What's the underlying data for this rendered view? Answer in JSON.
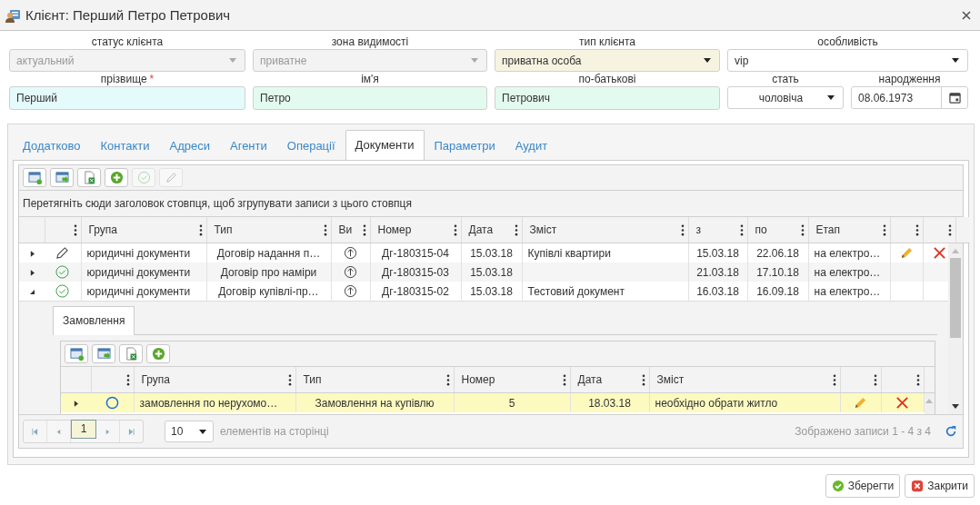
{
  "window": {
    "title": "Клієнт: Перший Петро Петрович"
  },
  "fields": [
    {
      "kind": "select",
      "label": "статус клієнта",
      "value": "актуальний",
      "disabled": true,
      "color": "#f3f3f3"
    },
    {
      "kind": "select",
      "label": "зона видимості",
      "value": "приватне",
      "disabled": true,
      "color": "#f3f3f3"
    },
    {
      "kind": "select",
      "label": "тип клієнта",
      "value": "приватна особа",
      "disabled": false,
      "color": "#f6f4e0"
    },
    {
      "kind": "select",
      "label": "особливість",
      "value": "vip",
      "disabled": false,
      "color": "#ffffff"
    },
    {
      "kind": "input",
      "label": "прізвище",
      "required_mark": "*",
      "value": "Перший",
      "color": "#e5fbfb"
    },
    {
      "kind": "input",
      "label": "ім'я",
      "value": "Петро",
      "color": "#e3fbee"
    },
    {
      "kind": "input",
      "label": "по-батькові",
      "value": "Петрович",
      "color": "#e3fbee"
    },
    {
      "kind": "select",
      "label": "стать",
      "value": "чоловіча",
      "disabled": false,
      "color": "#ffffff"
    },
    {
      "kind": "date",
      "label": "народження",
      "value": "08.06.1973",
      "color": "#ffffff"
    }
  ],
  "tabs": [
    {
      "label": "Додатково",
      "selected": false
    },
    {
      "label": "Контакти",
      "selected": false
    },
    {
      "label": "Адреси",
      "selected": false
    },
    {
      "label": "Агенти",
      "selected": false
    },
    {
      "label": "Операції",
      "selected": false
    },
    {
      "label": "Документи",
      "selected": true
    },
    {
      "label": "Параметри",
      "selected": false
    },
    {
      "label": "Аудит",
      "selected": false
    }
  ],
  "toolbar": [
    {
      "kind": "layout",
      "disabled": false
    },
    {
      "kind": "export",
      "disabled": false
    },
    {
      "kind": "excel",
      "disabled": false
    },
    {
      "kind": "add",
      "disabled": false
    },
    {
      "kind": "approve",
      "disabled": true
    },
    {
      "kind": "edit",
      "disabled": true
    }
  ],
  "group_hint": "Перетягніть сюди заголовок стовпця, щоб згрупувати записи з цього стовпця",
  "columns": [
    {
      "kind": "status"
    },
    {
      "kind": "text",
      "label": "Група"
    },
    {
      "kind": "text",
      "label": "Тип"
    },
    {
      "kind": "text",
      "label": "Ви"
    },
    {
      "kind": "text",
      "label": "Номер"
    },
    {
      "kind": "text",
      "label": "Дата"
    },
    {
      "kind": "text",
      "label": "Зміст"
    },
    {
      "kind": "text",
      "label": "з"
    },
    {
      "kind": "text",
      "label": "по"
    },
    {
      "kind": "text",
      "label": "Етап"
    },
    {
      "kind": "edit"
    },
    {
      "kind": "delete"
    }
  ],
  "rows": [
    {
      "kind": "edit",
      "expanded": false,
      "actions": true,
      "group": "юридичні документи",
      "type": "Договір надання п…",
      "number": "Дг-180315-04",
      "date": "15.03.18",
      "content": "Купівлі квартири",
      "from": "15.03.18",
      "to": "22.06.18",
      "stage": "на електро…"
    },
    {
      "kind": "done",
      "expanded": false,
      "actions": false,
      "group": "юридичні документи",
      "type": "Договір про наміри",
      "number": "Дг-180315-03",
      "date": "15.03.18",
      "from": "21.03.18",
      "to": "17.10.18",
      "stage": "на електро…"
    },
    {
      "kind": "done",
      "expanded": true,
      "actions": false,
      "group": "юридичні документи",
      "type": "Договір купівлі-пр…",
      "number": "Дг-180315-02",
      "date": "15.03.18",
      "content": "Тестовий документ",
      "from": "16.03.18",
      "to": "16.09.18",
      "stage": "на електро…"
    }
  ],
  "detail": {
    "tabs": [
      {
        "label": "Замовлення",
        "selected": true
      }
    ],
    "toolbar": [
      {
        "kind": "layout",
        "disabled": false
      },
      {
        "kind": "export",
        "disabled": false
      },
      {
        "kind": "excel",
        "disabled": false
      },
      {
        "kind": "add",
        "disabled": false
      }
    ],
    "columns": [
      {
        "kind": "status"
      },
      {
        "kind": "text",
        "label": "Група"
      },
      {
        "kind": "text",
        "label": "Тип"
      },
      {
        "kind": "text",
        "label": "Номер"
      },
      {
        "kind": "text",
        "label": "Дата"
      },
      {
        "kind": "text",
        "label": "Зміст"
      },
      {
        "kind": "edit"
      },
      {
        "kind": "delete"
      }
    ],
    "rows": [
      {
        "kind": "open",
        "selected": true,
        "group": "замовлення по нерухомо…",
        "type": "Замовлення на купівлю",
        "number": "5",
        "date": "18.03.18",
        "content": "необхідно обрати житло"
      }
    ]
  },
  "pager": {
    "pages": [
      {
        "label": "1",
        "selected": true
      }
    ],
    "page_size": "10",
    "page_size_label": "елементів на сторінці",
    "summary": "Зображено записи 1 - 4 з 4"
  },
  "buttons": [
    {
      "kind": "save",
      "label": "Зберегти"
    },
    {
      "kind": "close",
      "label": "Закрити"
    }
  ]
}
